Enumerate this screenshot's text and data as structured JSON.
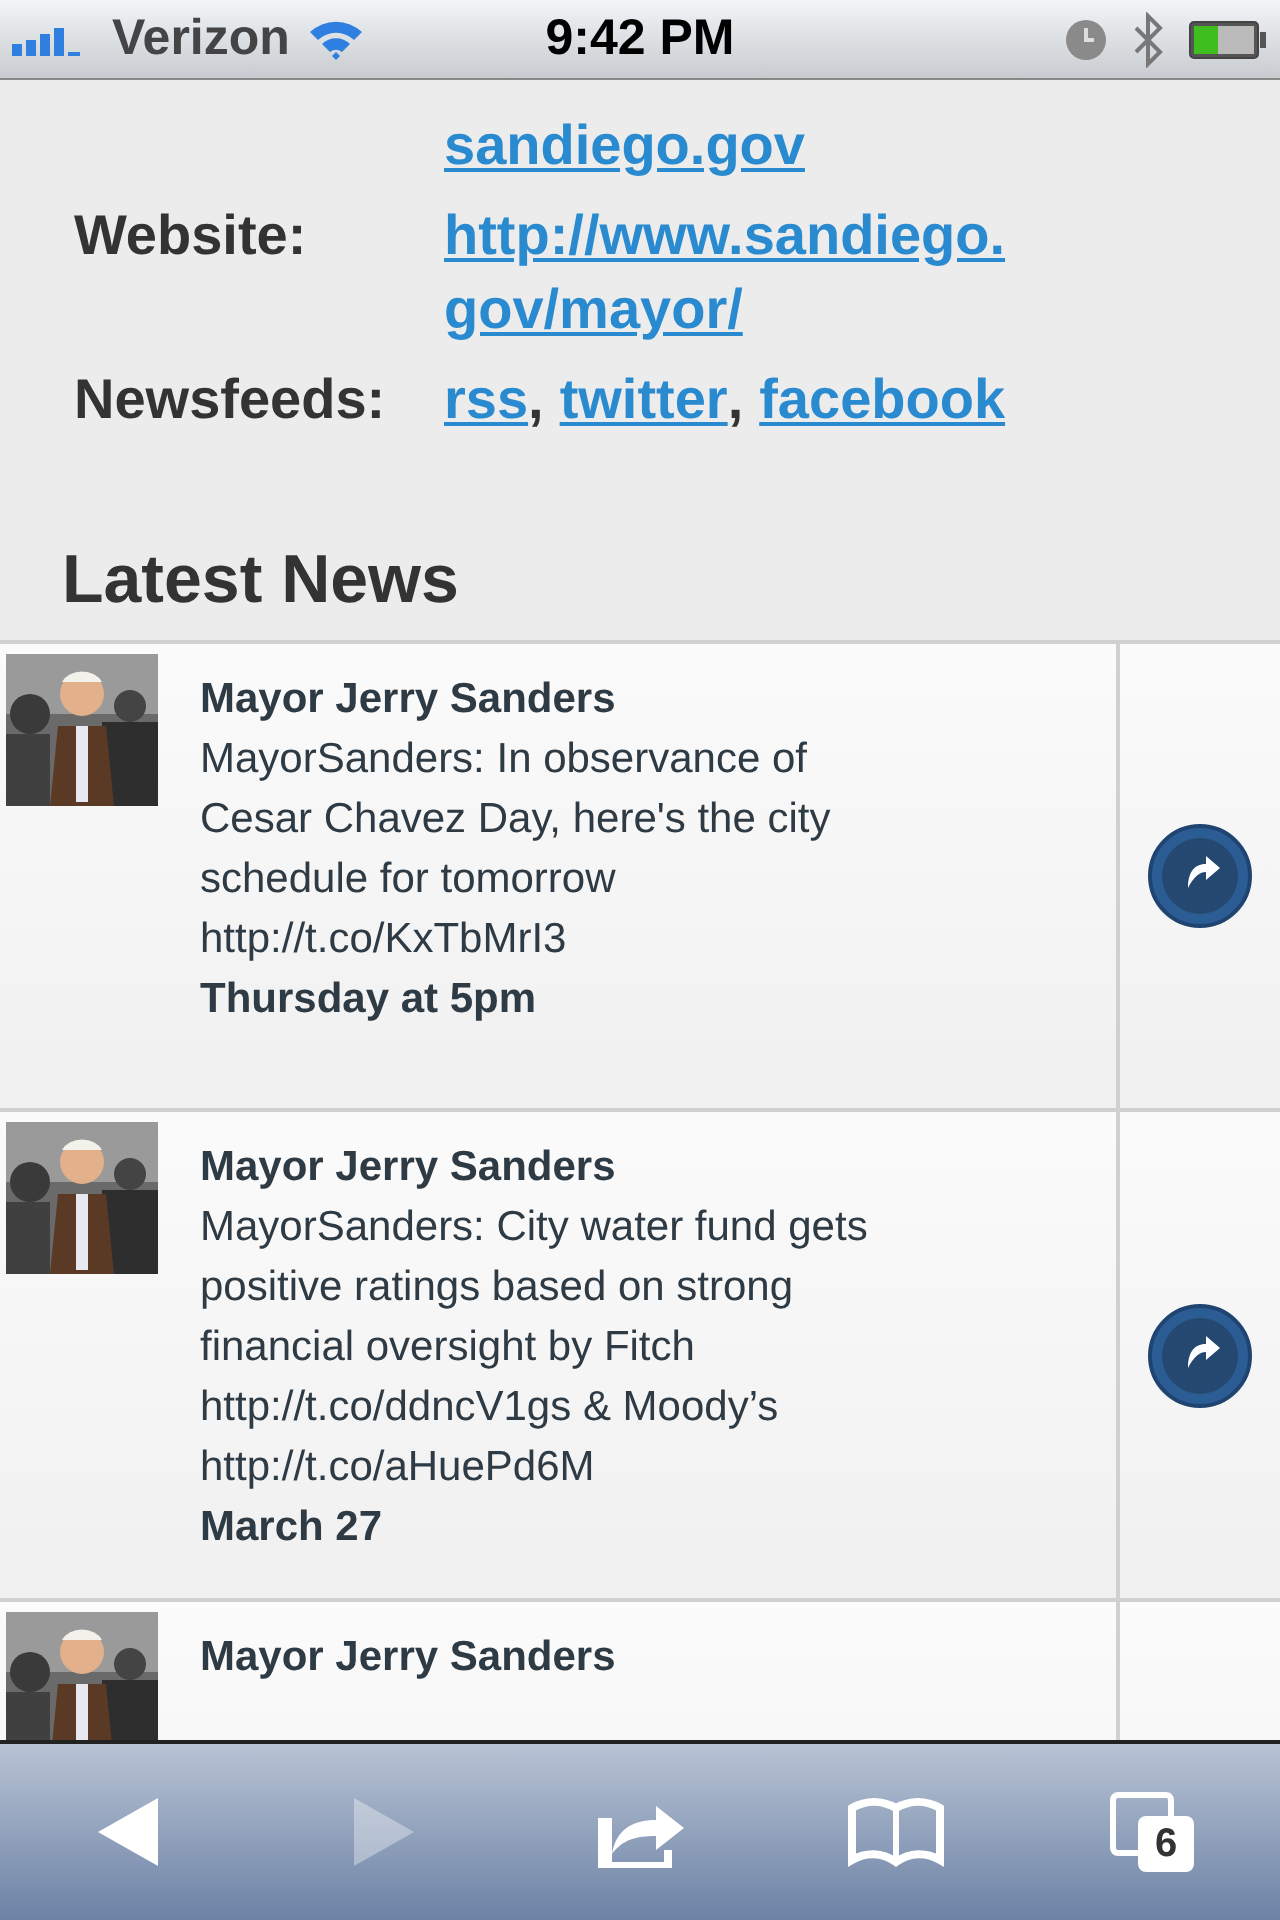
{
  "status_bar": {
    "carrier": "Verizon",
    "time": "9:42 PM"
  },
  "contact": [
    {
      "kind": "stacked",
      "links": [
        {
          "text": "sandiego.gov"
        }
      ]
    },
    {
      "kind": "stacked",
      "label": "Website:",
      "links": [
        {
          "text": "http://www.sandiego."
        },
        {
          "text": "gov/mayor/"
        }
      ]
    },
    {
      "kind": "inline",
      "label": "Newsfeeds:",
      "links": [
        {
          "text": "rss",
          "sep": ","
        },
        {
          "text": "twitter",
          "sep": ","
        },
        {
          "text": "facebook"
        }
      ]
    }
  ],
  "section_title": "Latest News",
  "news": [
    {
      "author": "Mayor Jerry Sanders",
      "body": "MayorSanders: In observance of Cesar Chavez Day, here's the city schedule for tomorrow http://t.co/KxTbMrI3",
      "date": "Thursday at 5pm"
    },
    {
      "author": "Mayor Jerry Sanders",
      "body": "MayorSanders: City water fund gets positive ratings based on strong financial oversight by Fitch http://t.co/ddncV1gs & Moody’s http://t.co/aHuePd6M",
      "date": "March 27"
    },
    {
      "author": "Mayor Jerry Sanders"
    }
  ],
  "toolbar": [
    {
      "kind": "back",
      "disabled": false
    },
    {
      "kind": "forward",
      "disabled": true
    },
    {
      "kind": "share",
      "disabled": false
    },
    {
      "kind": "bookmarks",
      "disabled": false
    },
    {
      "kind": "tabs",
      "disabled": false,
      "count": "6"
    }
  ]
}
